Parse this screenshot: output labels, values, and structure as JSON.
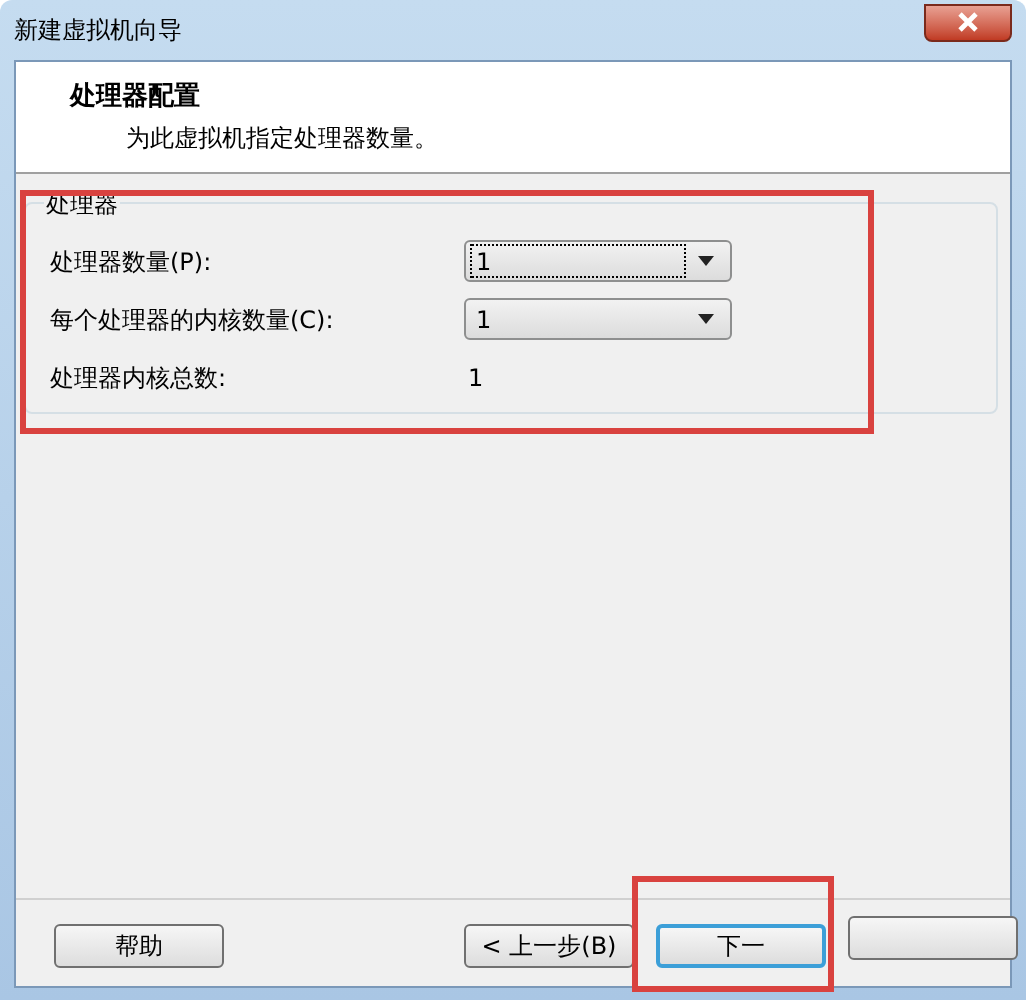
{
  "window": {
    "title": "新建虚拟机向导"
  },
  "header": {
    "title": "处理器配置",
    "subtitle": "为此虚拟机指定处理器数量。"
  },
  "group": {
    "label": "处理器",
    "highlighted": true,
    "rows": [
      {
        "kind": "combo",
        "label": "处理器数量(P):",
        "value": "1",
        "focused": true
      },
      {
        "kind": "combo",
        "label": "每个处理器的内核数量(C):",
        "value": "1",
        "focused": false
      },
      {
        "kind": "text",
        "label": "处理器内核总数:",
        "value": "1"
      }
    ]
  },
  "buttons": [
    {
      "label": "帮助",
      "highlighted": false,
      "default": false
    },
    {
      "label": "< 上一步(B)",
      "highlighted": false,
      "default": false
    },
    {
      "label": "下一",
      "highlighted": true,
      "default": true
    },
    {
      "highlighted": false,
      "default": false
    }
  ]
}
